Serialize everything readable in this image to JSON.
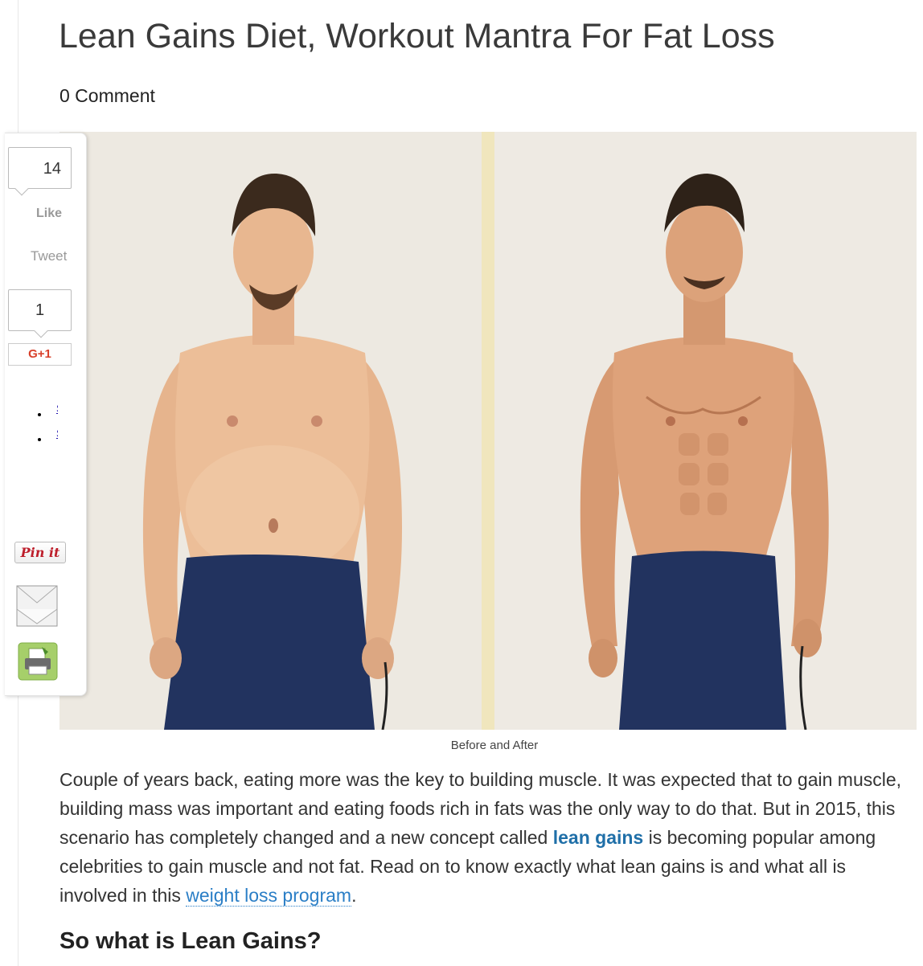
{
  "article": {
    "title": "Lean Gains Diet, Workout Mantra For Fat Loss",
    "comments": "0 Comment",
    "image_caption": "Before and After",
    "paragraph": {
      "part1": "Couple of years back, eating more was the key to building muscle. It was expected that to gain muscle, building mass was important and eating foods rich in fats was the only way to do that. But in 2015, this scenario has completely changed and a new concept called ",
      "link1": "lean gains",
      "part2": " is becoming popular among celebrities to gain muscle and not fat. Read on to know exactly what lean gains is and what all is involved in this ",
      "link2": "weight loss program",
      "part3": "."
    },
    "subheading": "So what is Lean Gains?"
  },
  "share_bar": {
    "facebook_count": "14",
    "like_label": "Like",
    "tweet_label": "Tweet",
    "gplus_count": "1",
    "gplus_label": "G+1",
    "bullet_items": [
      "S",
      "S"
    ],
    "pinit_label": "Pin it",
    "email_icon": "envelope-icon",
    "print_icon": "printer-icon"
  },
  "colors": {
    "link": "#1f6fa8",
    "gplus_red": "#d8402b",
    "pinit_red": "#bd1e2b"
  }
}
